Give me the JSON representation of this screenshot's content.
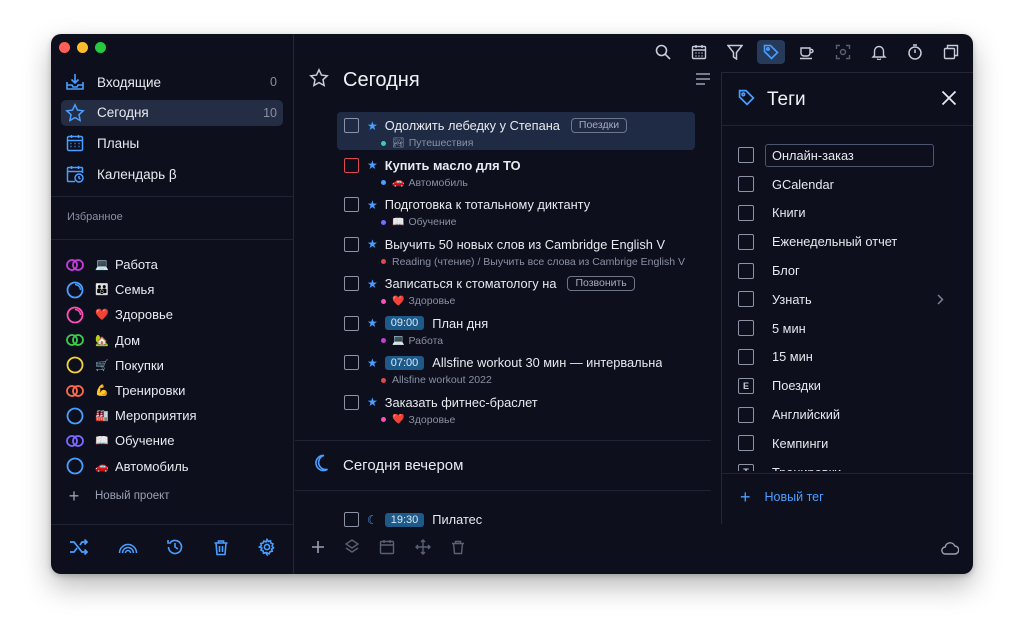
{
  "colors": {
    "accent": "#4a9eff",
    "bg": "#0d0f1c",
    "selected": "#1f2a44",
    "badge": "#1d5a8a",
    "close": "#ff5f57",
    "minimize": "#febc2e",
    "zoom": "#28c840"
  },
  "sidebar": {
    "nav": [
      {
        "label": "Входящие",
        "count": "0",
        "icon": "inbox-icon"
      },
      {
        "label": "Сегодня",
        "count": "10",
        "icon": "star-icon"
      },
      {
        "label": "Планы",
        "count": "",
        "icon": "calendar-icon"
      },
      {
        "label": "Календарь β",
        "count": "",
        "icon": "calendar-clock-icon"
      }
    ],
    "favorites_label": "Избранное",
    "projects": [
      {
        "emoji": "💻",
        "label": "Работа",
        "color": "#c53cdb",
        "ring": "double"
      },
      {
        "emoji": "👪",
        "label": "Семья",
        "color": "#4a9eff",
        "ring": "partial"
      },
      {
        "emoji": "❤️",
        "label": "Здоровье",
        "color": "#ff4fb4",
        "ring": "partial"
      },
      {
        "emoji": "🏡",
        "label": "Дом",
        "color": "#3ccb4a",
        "ring": "double"
      },
      {
        "emoji": "🛒",
        "label": "Покупки",
        "color": "#f4d03f",
        "ring": "single"
      },
      {
        "emoji": "💪",
        "label": "Тренировки",
        "color": "#ff6a4a",
        "ring": "double"
      },
      {
        "emoji": "🏭",
        "label": "Мероприятия",
        "color": "#4a9eff",
        "ring": "single"
      },
      {
        "emoji": "📖",
        "label": "Обучение",
        "color": "#7a6aff",
        "ring": "double"
      },
      {
        "emoji": "🚗",
        "label": "Автомобиль",
        "color": "#4a9eff",
        "ring": "single"
      }
    ],
    "new_project": "Новый проект",
    "bottom_icons": [
      "shuffle-icon",
      "rainbow-icon",
      "history-icon",
      "trash-icon",
      "settings-icon"
    ]
  },
  "main": {
    "title": "Сегодня",
    "tasks": [
      {
        "title": "Одолжить лебедку у Степана",
        "tag": "Поездки",
        "project": "Путешествия",
        "emoji": "🏞",
        "dot": "#3ccbb4",
        "star": true,
        "time": "",
        "checkbox": "normal",
        "bold": false,
        "selected": true
      },
      {
        "title": "Купить масло для ТО",
        "tag": "",
        "project": "Автомобиль",
        "emoji": "🚗",
        "dot": "#4a9eff",
        "star": true,
        "time": "",
        "checkbox": "red",
        "bold": true,
        "selected": false
      },
      {
        "title": "Подготовка к тотальному диктанту",
        "tag": "",
        "project": "Обучение",
        "emoji": "📖",
        "dot": "#7a6aff",
        "star": true,
        "time": "",
        "checkbox": "normal",
        "bold": false,
        "selected": false
      },
      {
        "title": "Выучить 50 новых слов из Cambridge English V",
        "tag": "",
        "project": "Reading (чтение) / Выучить все слова из Cambrige English V",
        "emoji": "",
        "dot": "#e0484f",
        "star": true,
        "time": "",
        "checkbox": "normal",
        "bold": false,
        "selected": false
      },
      {
        "title": "Записаться к стоматологу на",
        "tag": "Позвонить",
        "project": "Здоровье",
        "emoji": "❤️",
        "dot": "#ff4fb4",
        "star": true,
        "time": "",
        "checkbox": "normal",
        "bold": false,
        "selected": false
      },
      {
        "title": "План дня",
        "tag": "",
        "project": "Работа",
        "emoji": "💻",
        "dot": "#c53cdb",
        "star": true,
        "time": "09:00",
        "checkbox": "normal",
        "bold": false,
        "selected": false
      },
      {
        "title": "Allsfine workout 30 мин — интервальна",
        "tag": "",
        "project": "Allsfine workout 2022",
        "emoji": "",
        "dot": "#e0484f",
        "star": true,
        "time": "07:00",
        "checkbox": "normal",
        "bold": false,
        "selected": false
      },
      {
        "title": "Заказать фитнес-браслет",
        "tag": "",
        "project": "Здоровье",
        "emoji": "❤️",
        "dot": "#ff4fb4",
        "star": true,
        "time": "",
        "checkbox": "normal",
        "bold": false,
        "selected": false
      }
    ],
    "evening": {
      "title": "Сегодня вечером",
      "task": {
        "time": "19:30",
        "title": "Пилатес"
      }
    },
    "bottom_icons": [
      "add-icon",
      "layers-icon",
      "calendar-icon",
      "move-icon",
      "trash-icon"
    ]
  },
  "toolbar": [
    "search-icon",
    "calendar-icon",
    "filter-icon",
    "tag-icon",
    "coffee-icon",
    "focus-icon",
    "bell-icon",
    "timer-icon",
    "window-icon"
  ],
  "tags_panel": {
    "title": "Теги",
    "tags": [
      {
        "name": "Онлайн-заказ",
        "editing": true,
        "mark": "",
        "chevron": false
      },
      {
        "name": "GCalendar",
        "editing": false,
        "mark": "",
        "chevron": false
      },
      {
        "name": "Книги",
        "editing": false,
        "mark": "",
        "chevron": false
      },
      {
        "name": "Еженедельный отчет",
        "editing": false,
        "mark": "",
        "chevron": false
      },
      {
        "name": "Блог",
        "editing": false,
        "mark": "",
        "chevron": false
      },
      {
        "name": "Узнать",
        "editing": false,
        "mark": "",
        "chevron": true
      },
      {
        "name": "5 мин",
        "editing": false,
        "mark": "",
        "chevron": false
      },
      {
        "name": "15 мин",
        "editing": false,
        "mark": "",
        "chevron": false
      },
      {
        "name": "Поездки",
        "editing": false,
        "mark": "E",
        "chevron": false
      },
      {
        "name": "Английский",
        "editing": false,
        "mark": "",
        "chevron": false
      },
      {
        "name": "Кемпинги",
        "editing": false,
        "mark": "",
        "chevron": false
      },
      {
        "name": "Тренировки",
        "editing": false,
        "mark": "T",
        "chevron": false
      }
    ],
    "new_tag": "Новый тег"
  }
}
